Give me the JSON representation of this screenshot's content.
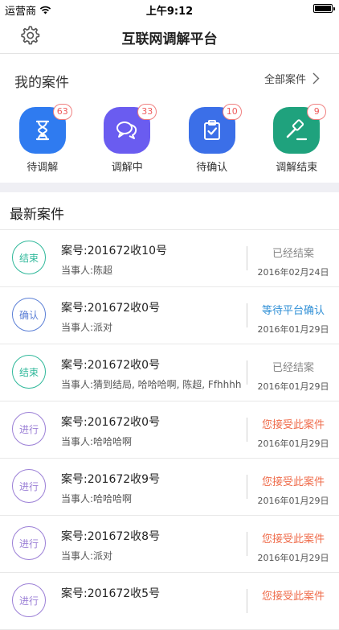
{
  "status_bar": {
    "carrier": "运营商",
    "time": "上午9:12"
  },
  "nav": {
    "title": "互联网调解平台",
    "settings_icon": "gear-icon"
  },
  "my_cases": {
    "title": "我的案件",
    "all_link": "全部案件",
    "types": [
      {
        "label": "待调解",
        "count": "63",
        "icon": "hourglass-icon",
        "color": "#2f7bf0"
      },
      {
        "label": "调解中",
        "count": "33",
        "icon": "chat-bubbles-icon",
        "color": "#6a5cf0"
      },
      {
        "label": "待确认",
        "count": "10",
        "icon": "clipboard-check-icon",
        "color": "#3b6fe8"
      },
      {
        "label": "调解结束",
        "count": "9",
        "icon": "gavel-icon",
        "color": "#1fa27d"
      }
    ]
  },
  "latest": {
    "title": "最新案件",
    "rows": [
      {
        "badge": "结束",
        "case_no": "案号:201672收10号",
        "party": "当事人:陈超",
        "status": "已经结案",
        "date": "2016年02月24日",
        "badge_color": "#2fb89a",
        "status_color": "#888888"
      },
      {
        "badge": "确认",
        "case_no": "案号:201672收0号",
        "party": "当事人:派对",
        "status": "等待平台确认",
        "date": "2016年01月29日",
        "badge_color": "#5b7fd6",
        "status_color": "#2f8fd6"
      },
      {
        "badge": "结束",
        "case_no": "案号:201672收0号",
        "party": "当事人:猜到结局, 哈哈哈啊, 陈超, Ffhhhh",
        "status": "已经结案",
        "date": "2016年01月29日",
        "badge_color": "#2fb89a",
        "status_color": "#888888"
      },
      {
        "badge": "进行",
        "case_no": "案号:201672收0号",
        "party": "当事人:哈哈哈啊",
        "status": "您接受此案件",
        "date": "2016年01月29日",
        "badge_color": "#9b7fd6",
        "status_color": "#ef6b4a"
      },
      {
        "badge": "进行",
        "case_no": "案号:201672收9号",
        "party": "当事人:哈哈哈啊",
        "status": "您接受此案件",
        "date": "2016年01月29日",
        "badge_color": "#9b7fd6",
        "status_color": "#ef6b4a"
      },
      {
        "badge": "进行",
        "case_no": "案号:201672收8号",
        "party": "当事人:派对",
        "status": "您接受此案件",
        "date": "2016年01月29日",
        "badge_color": "#9b7fd6",
        "status_color": "#ef6b4a"
      },
      {
        "badge": "进行",
        "case_no": "案号:201672收5号",
        "party": "",
        "status": "您接受此案件",
        "date": "",
        "badge_color": "#9b7fd6",
        "status_color": "#ef6b4a"
      }
    ]
  }
}
